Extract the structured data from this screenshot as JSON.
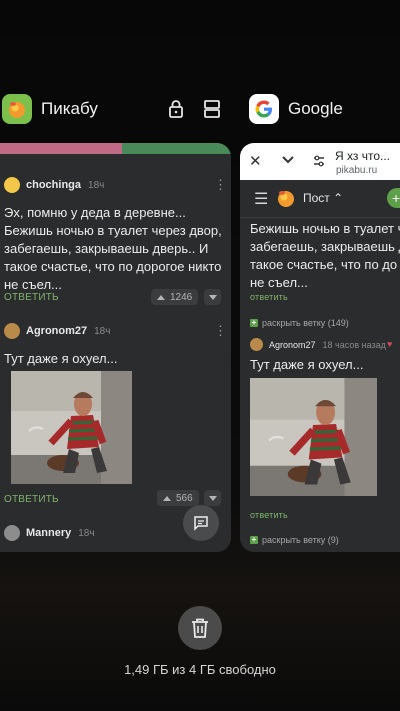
{
  "pikabu_app": {
    "name": "Пикабу",
    "comment1": {
      "user": "chochinga",
      "time": "18ч",
      "text_lines": [
        "Эх, помню у деда в деревне...",
        "Бежишь ночью в туалет через двор,",
        "забегаешь, закрываешь дверь.. И",
        "такое счастье, что по дорогое никто",
        "не съел..."
      ],
      "reply": "ОТВЕТИТЬ",
      "rating": "1246"
    },
    "comment2": {
      "user": "Agronom27",
      "time": "18ч",
      "text": "Тут даже я охуел...",
      "reply": "ОТВЕТИТЬ",
      "rating": "566"
    },
    "comment3": {
      "user": "Mannery",
      "time": "18ч"
    }
  },
  "chrome_app": {
    "name": "Google",
    "tab_title": "Я хз что...",
    "url": "pikabu.ru",
    "post_label": "Пост",
    "comment1": {
      "text_lines": [
        "Бежишь ночью в туалет ч",
        "забегаешь, закрываешь д",
        "такое счастье, что по до",
        "не съел..."
      ],
      "reply": "ответить"
    },
    "expand1": "раскрыть ветку (149)",
    "comment2": {
      "user": "Agronom27",
      "time": "18 часов назад",
      "text": "Тут даже я охуел...",
      "reply": "ответить"
    },
    "expand2": "раскрыть ветку (9)"
  },
  "memory_text": "1,49 ГБ из 4 ГБ свободно",
  "colors": {
    "pikabu_green": "#7fb56a",
    "chrome_plus": "#5e9f4a",
    "card_bg": "#2b2c2d"
  }
}
